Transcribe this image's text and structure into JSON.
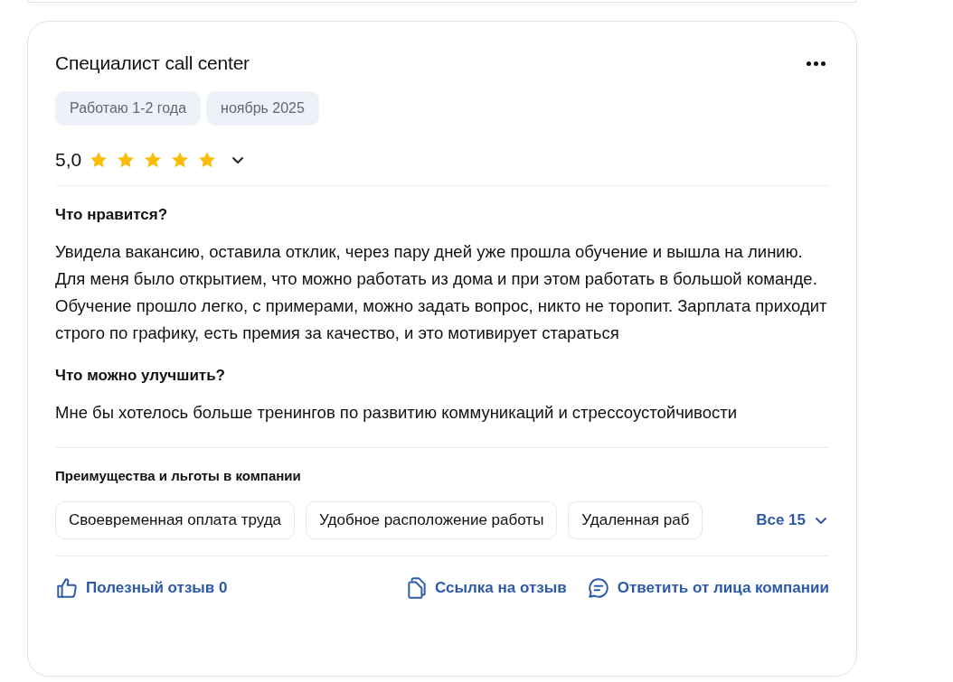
{
  "review": {
    "title": "Специалист call center",
    "tags": [
      "Работаю 1-2 года",
      "ноябрь 2025"
    ],
    "rating": "5,0",
    "stars": 5,
    "sections": [
      {
        "heading": "Что нравится?",
        "text": "Увидела вакансию, оставила отклик, через пару дней уже прошла обучение и вышла на линию. Для меня было открытием, что можно работать из дома и при этом работать в большой команде. Обучение прошло легко, с примерами, можно задать вопрос, никто не торопит. Зарплата приходит строго по графику, есть премия за качество, и это мотивирует стараться"
      },
      {
        "heading": "Что можно улучшить?",
        "text": "Мне бы хотелось больше тренингов по развитию коммуникаций и стрессоустойчивости"
      }
    ],
    "benefits": {
      "heading": "Преимущества и льготы в компании",
      "items": [
        "Своевременная оплата труда",
        "Удобное расположение работы",
        "Удаленная раб"
      ],
      "more": "Все 15"
    },
    "actions": [
      {
        "kind": "like",
        "label": "Полезный отзыв 0"
      },
      {
        "kind": "link",
        "label": "Ссылка на отзыв"
      },
      {
        "kind": "reply",
        "label": "Ответить от лица компании"
      }
    ]
  }
}
